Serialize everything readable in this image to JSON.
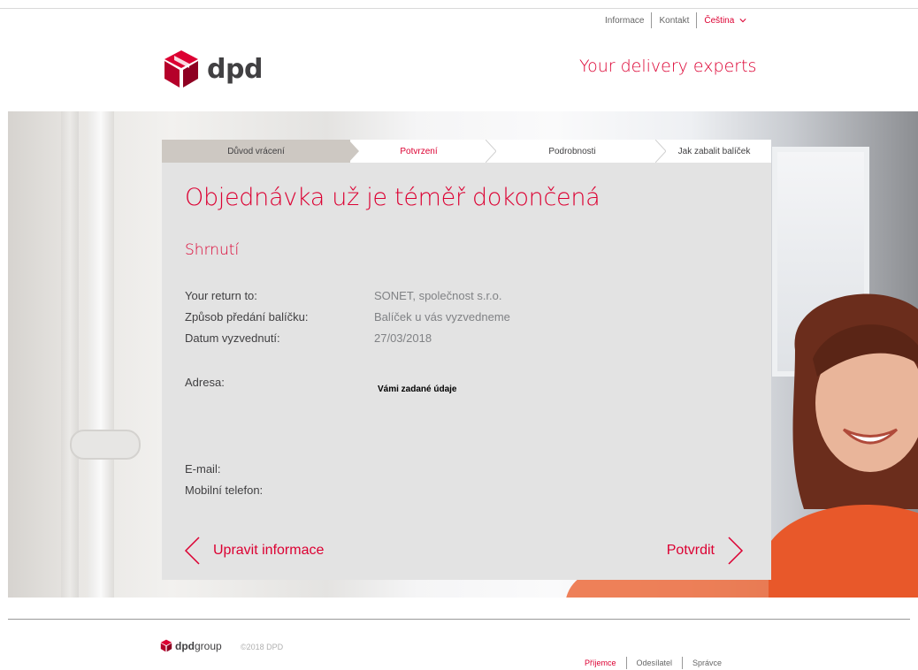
{
  "topnav": {
    "items": [
      "Informace",
      "Kontakt"
    ],
    "language": "Čeština"
  },
  "brand": {
    "logo_text": "dpd",
    "tagline": "Your delivery experts"
  },
  "steps": [
    {
      "label": "Důvod vrácení",
      "state": "done"
    },
    {
      "label": "Potvrzení",
      "state": "active"
    },
    {
      "label": "Podrobnosti",
      "state": "pending"
    },
    {
      "label": "Jak zabalit balíček",
      "state": "pending"
    }
  ],
  "main": {
    "title": "Objednávka už je téměř dokončená",
    "subtitle": "Shrnutí",
    "rows": [
      {
        "label": "Your return to:",
        "value": "SONET, společnost s.r.o."
      },
      {
        "label": "Způsob předání balíčku:",
        "value": "Balíček u vás vyzvedneme"
      },
      {
        "label": "Datum vyzvednutí:",
        "value": "27/03/2018"
      }
    ],
    "address_label": "Adresa:",
    "address_value": "Vámi zadané údaje",
    "email_label": "E-mail:",
    "phone_label": "Mobilní telefon:",
    "back_label": "Upravit informace",
    "confirm_label": "Potvrdit"
  },
  "footer": {
    "logo_bold": "dpd",
    "logo_light": "group",
    "copyright": "©2018 DPD",
    "links": [
      {
        "label": "Příjemce",
        "active": true
      },
      {
        "label": "Odesílatel",
        "active": false
      },
      {
        "label": "Správce",
        "active": false
      }
    ]
  },
  "colors": {
    "brand_red": "#dc0032",
    "text_dark": "#414042",
    "card_bg": "#e3e3e3",
    "step_done_bg": "#cdc8c2"
  }
}
